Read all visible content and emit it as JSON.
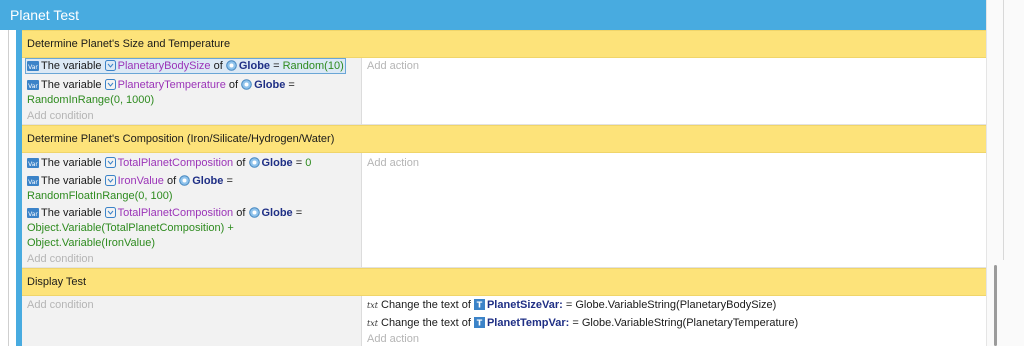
{
  "group": {
    "title": "Planet Test"
  },
  "blocks": [
    {
      "comment": "Determine Planet's Size and Temperature",
      "conditions": [
        {
          "prefix": "The variable",
          "variable": "PlanetaryBodySize",
          "of": "of",
          "object": "Globe",
          "op": "=",
          "value": "Random(10)"
        },
        {
          "prefix": "The variable",
          "variable": "PlanetaryTemperature",
          "of": "of",
          "object": "Globe",
          "op": "=",
          "value": "RandomInRange(0, 1000)"
        }
      ],
      "add_condition": "Add condition",
      "add_action": "Add action"
    },
    {
      "comment": "Determine Planet's Composition (Iron/Silicate/Hydrogen/Water)",
      "conditions": [
        {
          "prefix": "The variable",
          "variable": "TotalPlanetComposition",
          "of": "of",
          "object": "Globe",
          "op": "=",
          "value": "0"
        },
        {
          "prefix": "The variable",
          "variable": "IronValue",
          "of": "of",
          "object": "Globe",
          "op": "=",
          "value": "RandomFloatInRange(0, 100)"
        },
        {
          "prefix": "The variable",
          "variable": "TotalPlanetComposition",
          "of": "of",
          "object": "Globe",
          "op": "=",
          "value_line1": "Object.Variable(TotalPlanetComposition) +",
          "value_line2": "Object.Variable(IronValue)"
        }
      ],
      "add_condition": "Add condition",
      "add_action": "Add action"
    },
    {
      "comment": "Display Test",
      "add_condition": "Add condition",
      "actions": [
        {
          "prefix": "Change the text of",
          "object": "PlanetSizeVar",
          "op": ":",
          "op2": "=",
          "value": "Globe.VariableString(PlanetaryBodySize)"
        },
        {
          "prefix": "Change the text of",
          "object": "PlanetTempVar",
          "op": ":",
          "op2": "=",
          "value": "Globe.VariableString(PlanetaryTemperature)"
        }
      ],
      "add_action": "Add action"
    }
  ],
  "icons": {
    "var_icon": "variable-icon",
    "scene_var_icon": "scene-variable-icon",
    "object_icon": "globe-object-icon",
    "text_icon": "text-action-icon",
    "text_object_icon": "text-object-icon"
  },
  "colors": {
    "header": "#48abe0",
    "comment": "#fde37a",
    "variable": "#9b34b8",
    "object": "#1f2f85",
    "value": "#2e8b1f"
  }
}
